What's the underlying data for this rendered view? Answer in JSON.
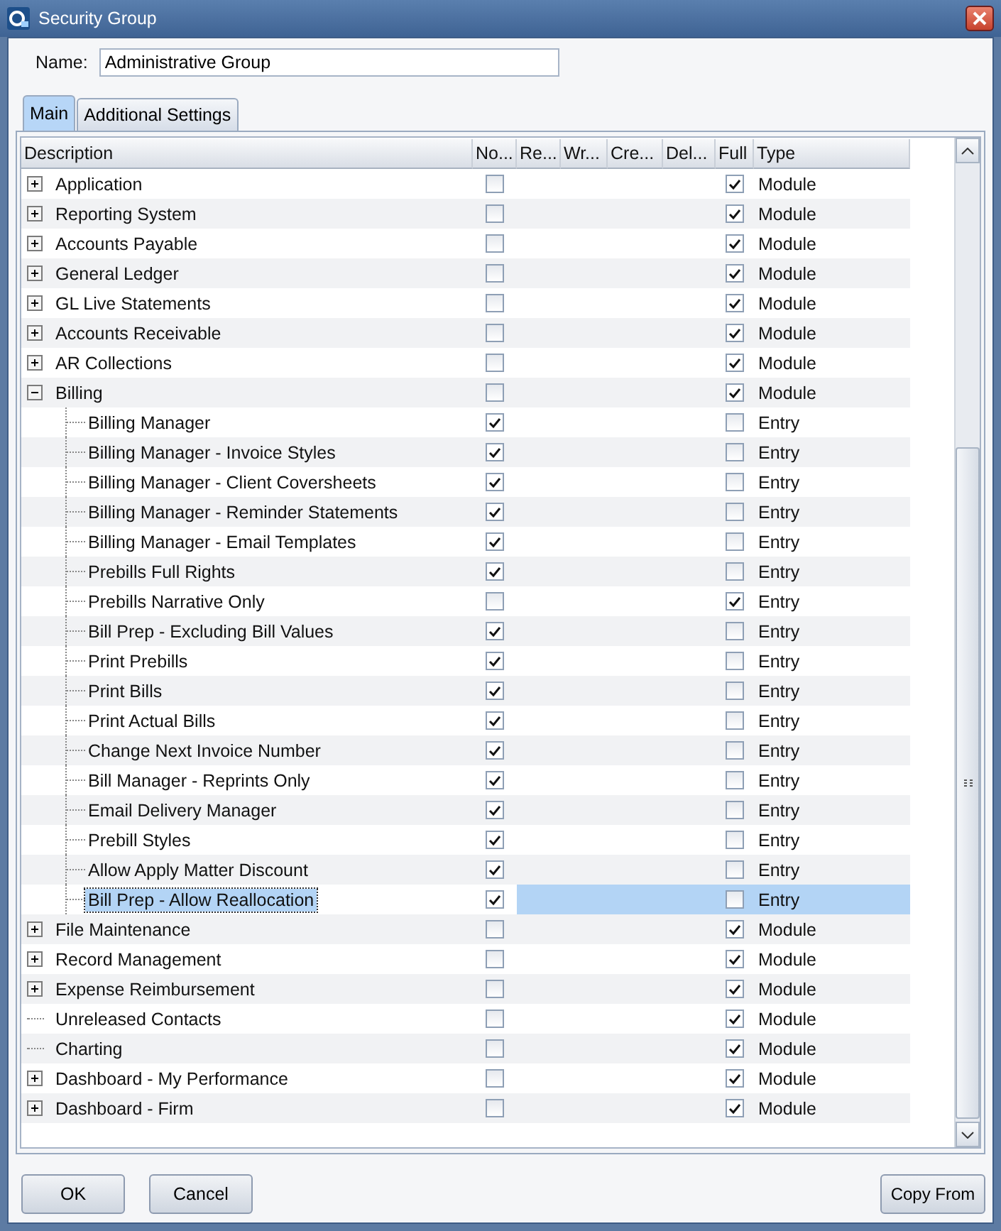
{
  "window": {
    "title": "Security Group"
  },
  "name_field": {
    "label": "Name:",
    "value": "Administrative Group"
  },
  "tabs": [
    {
      "label": "Main",
      "selected": true
    },
    {
      "label": "Additional Settings",
      "selected": false
    }
  ],
  "table": {
    "columns": [
      "Description",
      "No...",
      "Re...",
      "Wr...",
      "Cre...",
      "Del...",
      "Full",
      "Type"
    ],
    "rows": [
      {
        "description": "Application",
        "expanded": false,
        "no": false,
        "full": true,
        "type": "Module",
        "selected": false
      },
      {
        "description": "Reporting System",
        "expanded": false,
        "no": false,
        "full": true,
        "type": "Module",
        "selected": false
      },
      {
        "description": "Accounts Payable",
        "expanded": false,
        "no": false,
        "full": true,
        "type": "Module",
        "selected": false
      },
      {
        "description": "General Ledger",
        "expanded": false,
        "no": false,
        "full": true,
        "type": "Module",
        "selected": false
      },
      {
        "description": "GL Live Statements",
        "expanded": false,
        "no": false,
        "full": true,
        "type": "Module",
        "selected": false
      },
      {
        "description": "Accounts Receivable",
        "expanded": false,
        "no": false,
        "full": true,
        "type": "Module",
        "selected": false
      },
      {
        "description": "AR Collections",
        "expanded": false,
        "no": false,
        "full": true,
        "type": "Module",
        "selected": false
      },
      {
        "description": "Billing",
        "expanded": true,
        "no": false,
        "full": true,
        "type": "Module",
        "selected": false,
        "children": [
          {
            "description": "Billing Manager",
            "no": true,
            "full": false,
            "type": "Entry",
            "selected": false
          },
          {
            "description": "Billing Manager - Invoice Styles",
            "no": true,
            "full": false,
            "type": "Entry",
            "selected": false
          },
          {
            "description": "Billing Manager - Client Coversheets",
            "no": true,
            "full": false,
            "type": "Entry",
            "selected": false
          },
          {
            "description": "Billing Manager - Reminder Statements",
            "no": true,
            "full": false,
            "type": "Entry",
            "selected": false
          },
          {
            "description": "Billing Manager - Email Templates",
            "no": true,
            "full": false,
            "type": "Entry",
            "selected": false
          },
          {
            "description": "Prebills Full Rights",
            "no": true,
            "full": false,
            "type": "Entry",
            "selected": false
          },
          {
            "description": "Prebills Narrative Only",
            "no": false,
            "full": true,
            "type": "Entry",
            "selected": false
          },
          {
            "description": "Bill Prep - Excluding Bill Values",
            "no": true,
            "full": false,
            "type": "Entry",
            "selected": false
          },
          {
            "description": "Print Prebills",
            "no": true,
            "full": false,
            "type": "Entry",
            "selected": false
          },
          {
            "description": "Print Bills",
            "no": true,
            "full": false,
            "type": "Entry",
            "selected": false
          },
          {
            "description": "Print Actual Bills",
            "no": true,
            "full": false,
            "type": "Entry",
            "selected": false
          },
          {
            "description": "Change Next Invoice Number",
            "no": true,
            "full": false,
            "type": "Entry",
            "selected": false
          },
          {
            "description": "Bill Manager - Reprints Only",
            "no": true,
            "full": false,
            "type": "Entry",
            "selected": false
          },
          {
            "description": "Email Delivery Manager",
            "no": true,
            "full": false,
            "type": "Entry",
            "selected": false
          },
          {
            "description": "Prebill Styles",
            "no": true,
            "full": false,
            "type": "Entry",
            "selected": false
          },
          {
            "description": "Allow Apply Matter Discount",
            "no": true,
            "full": false,
            "type": "Entry",
            "selected": false
          },
          {
            "description": "Bill Prep - Allow Reallocation",
            "no": true,
            "full": false,
            "type": "Entry",
            "selected": true
          }
        ]
      },
      {
        "description": "File Maintenance",
        "expanded": false,
        "no": false,
        "full": true,
        "type": "Module",
        "selected": false
      },
      {
        "description": "Record Management",
        "expanded": false,
        "no": false,
        "full": true,
        "type": "Module",
        "selected": false
      },
      {
        "description": "Expense Reimbursement",
        "expanded": false,
        "no": false,
        "full": true,
        "type": "Module",
        "selected": false
      },
      {
        "description": "Unreleased Contacts",
        "no": false,
        "full": true,
        "type": "Module",
        "selected": false
      },
      {
        "description": "Charting",
        "no": false,
        "full": true,
        "type": "Module",
        "selected": false
      },
      {
        "description": "Dashboard - My Performance",
        "expanded": false,
        "no": false,
        "full": true,
        "type": "Module",
        "selected": false
      },
      {
        "description": "Dashboard - Firm",
        "expanded": false,
        "no": false,
        "full": true,
        "type": "Module",
        "selected": false
      }
    ]
  },
  "buttons": [
    {
      "label": "OK",
      "kind": "left"
    },
    {
      "label": "Cancel",
      "kind": "left"
    },
    {
      "label": "Copy From",
      "kind": "right"
    }
  ]
}
